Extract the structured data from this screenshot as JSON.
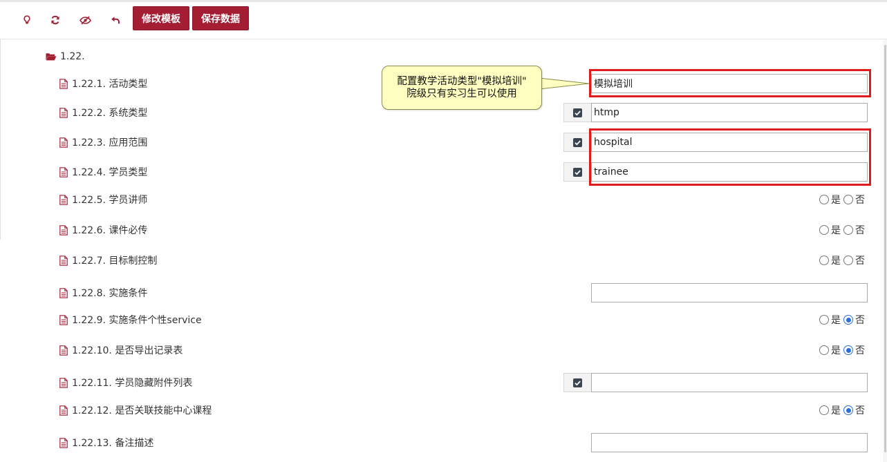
{
  "toolbar": {
    "icons": [
      "lightbulb-icon",
      "refresh-icon",
      "eye-slash-icon",
      "undo-icon"
    ],
    "edit_template": "修改模板",
    "save_data": "保存数据"
  },
  "tree": {
    "group_label": "1.22.",
    "rows": [
      {
        "label": "1.22.1. 活动类型",
        "value": "模拟培训"
      },
      {
        "label": "1.22.2. 系统类型",
        "value": "htmp"
      },
      {
        "label": "1.22.3. 应用范围",
        "value": "hospital"
      },
      {
        "label": "1.22.4. 学员类型",
        "value": "trainee"
      },
      {
        "label": "1.22.5. 学员讲师",
        "selected": "none"
      },
      {
        "label": "1.22.6. 课件必传",
        "selected": "none"
      },
      {
        "label": "1.22.7. 目标制控制",
        "selected": "none"
      },
      {
        "label": "1.22.8. 实施条件",
        "value": ""
      },
      {
        "label": "1.22.9. 实施条件个性service",
        "selected": "否"
      },
      {
        "label": "1.22.10. 是否导出记录表",
        "selected": "否"
      },
      {
        "label": "1.22.11. 学员隐藏附件列表",
        "value": ""
      },
      {
        "label": "1.22.12. 是否关联技能中心课程",
        "selected": "否"
      },
      {
        "label": "1.22.13. 备注描述",
        "value": ""
      }
    ],
    "yes_label": "是",
    "no_label": "否"
  },
  "callout": {
    "line1": "配置教学活动类型\"模拟培训\"",
    "line2": "院级只有实习生可以使用"
  },
  "colors": {
    "brand": "#a31d33",
    "highlight": "#e11b1b",
    "radio_selected": "#2a6fd6",
    "callout_bg": "#ffffc1"
  }
}
